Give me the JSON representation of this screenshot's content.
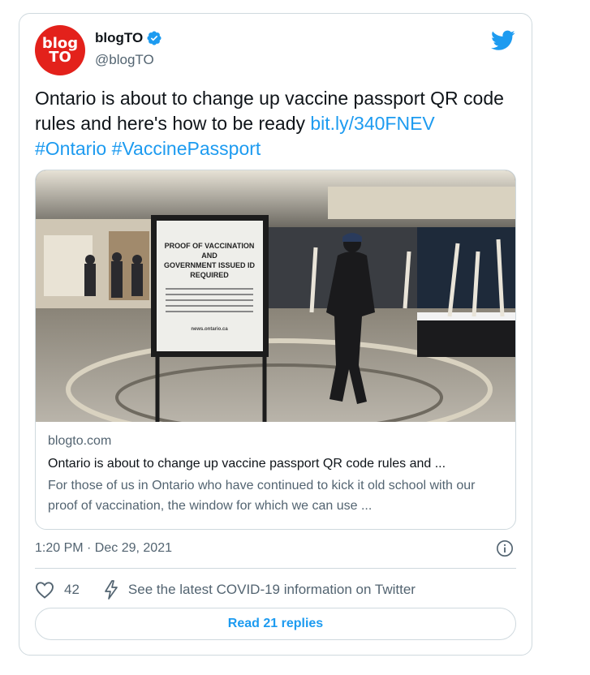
{
  "author": {
    "avatar_line1": "blog",
    "avatar_line2": "TO",
    "name": "blogTO",
    "handle": "@blogTO",
    "verified_icon": "verified-badge-icon"
  },
  "brand_icon": "twitter-bird-icon",
  "tweet": {
    "text": "Ontario is about to change up vaccine passport QR code rules and here's how to be ready ",
    "link": "bit.ly/340FNEV",
    "hashtag1": "#Ontario",
    "hashtag2": "#VaccinePassport"
  },
  "link_card": {
    "photo_sign_title_1": "PROOF OF VACCINATION",
    "photo_sign_title_2": "AND",
    "photo_sign_title_3": "GOVERNMENT ISSUED ID",
    "photo_sign_title_4": "REQUIRED",
    "photo_sign_footer": "news.ontario.ca",
    "domain": "blogto.com",
    "title": "Ontario is about to change up vaccine passport QR code rules and ...",
    "description": "For those of us in Ontario who have continued to kick it old school with our proof of vaccination, the window for which we can use ..."
  },
  "meta": {
    "timestamp": "1:20 PM · Dec 29, 2021",
    "info_icon": "info-icon"
  },
  "actions": {
    "like_count": "42",
    "covid_text": "See the latest COVID-19 information on Twitter"
  },
  "replies_button": "Read 21 replies",
  "colors": {
    "accent": "#1d9bf0",
    "avatar_red": "#e3211b",
    "muted_text": "#536471",
    "border": "#cfd9de"
  }
}
